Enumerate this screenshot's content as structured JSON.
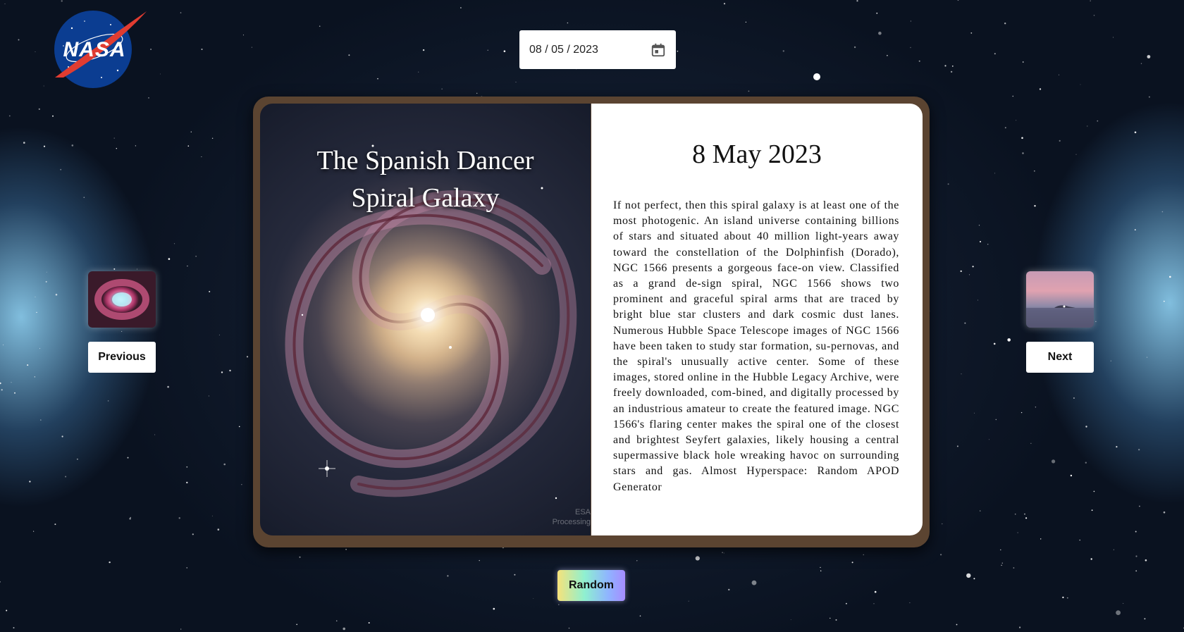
{
  "logo": {
    "text": "NASA"
  },
  "date_picker": {
    "value": "08 / 05 / 2023"
  },
  "book": {
    "image_title_line1": "The Spanish Dancer",
    "image_title_line2": "Spiral Galaxy",
    "image_credit_line1": "ESA",
    "image_credit_line2": "Processing",
    "date_heading": "8 May 2023",
    "explanation": "If not perfect, then this spiral galaxy is at least one of the most photogenic. An island universe containing billions of stars and situated about 40 million light-years away toward the constellation of the Dolphinfish (Dorado), NGC 1566 presents a gorgeous face-on view. Classified as a grand de-sign spiral, NGC 1566 shows two prominent and graceful spiral arms that are traced by bright blue star clusters and dark cosmic dust lanes. Numerous Hubble Space Telescope images of NGC 1566 have been taken to study star formation, su-pernovas, and the spiral's unusually active center. Some of these images, stored online in the Hubble Legacy Archive, were freely downloaded, com-bined, and digitally processed by an industrious amateur to create the featured image. NGC 1566's flaring center makes the spiral one of the closest and brightest Seyfert galaxies, likely housing a central supermassive black hole wreaking havoc on surrounding stars and gas. Almost Hyperspace: Random APOD Generator"
  },
  "navigation": {
    "previous_label": "Previous",
    "next_label": "Next",
    "random_label": "Random"
  },
  "icons": {
    "calendar": "calendar-icon",
    "logo": "nasa-logo"
  },
  "colors": {
    "book_frame": "#5b4431",
    "page_background": "#ffffff",
    "logo_blue": "#0b3d91",
    "logo_red": "#e03c31"
  }
}
